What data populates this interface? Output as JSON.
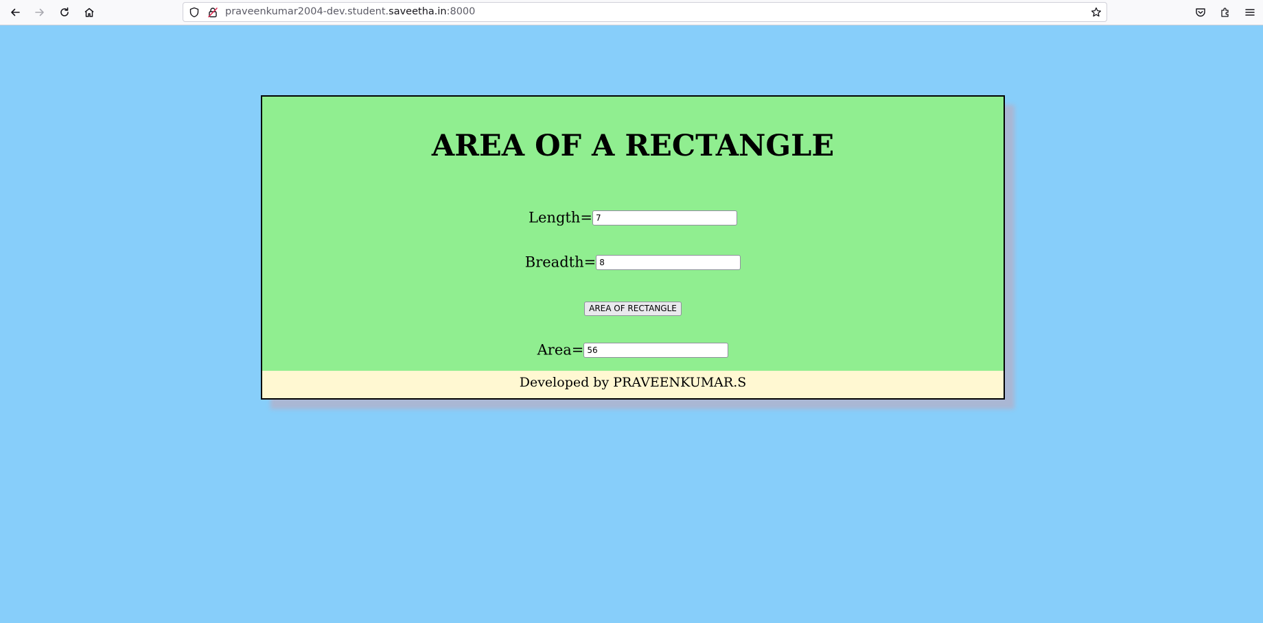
{
  "browser": {
    "url_prefix": "praveenkumar2004-dev.student.",
    "url_host": "saveetha.in",
    "url_suffix": ":8000"
  },
  "page": {
    "title": "AREA OF A RECTANGLE",
    "length_label": "Length=",
    "length_value": "7",
    "breadth_label": "Breadth=",
    "breadth_value": "8",
    "button_label": "AREA OF RECTANGLE",
    "area_label": "Area=",
    "area_value": "56",
    "footer": "Developed by PRAVEENKUMAR.S"
  },
  "colors": {
    "page_background": "#87cefa",
    "card_background": "#90ee90",
    "footer_background": "#fff8d2"
  }
}
